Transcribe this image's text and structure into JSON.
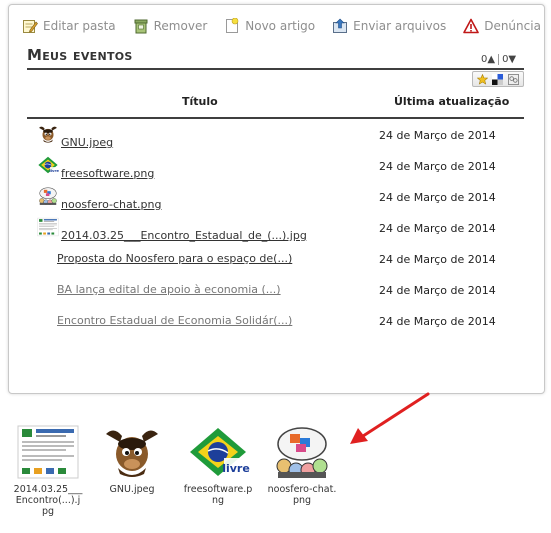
{
  "toolbar": {
    "edit_folder": "Editar pasta",
    "remove": "Remover",
    "new_article": "Novo artigo",
    "send_files": "Enviar arquivos",
    "report": "Denúncia"
  },
  "title": "Meus eventos",
  "votes": {
    "up": "0▲",
    "down": "0▼"
  },
  "table": {
    "headers": {
      "title": "Título",
      "updated": "Última atualização"
    },
    "rows": [
      {
        "name": "GNU.jpeg",
        "date": "24 de Março de 2014",
        "thumb": "gnu-thumbnail",
        "muted": false
      },
      {
        "name": "freesoftware.png",
        "date": "24 de Março de 2014",
        "thumb": "freesoftware-thumbnail",
        "muted": false
      },
      {
        "name": "noosfero-chat.png",
        "date": "24 de Março de 2014",
        "thumb": "noosfero-chat-thumbnail",
        "muted": false
      },
      {
        "name": "2014.03.25___Encontro_Estadual_de_(...).jpg",
        "date": "24 de Março de 2014",
        "thumb": "encontro-thumbnail",
        "muted": false
      },
      {
        "name": "Proposta do Noosfero para o espaço de(...)",
        "date": "24 de Março de 2014",
        "thumb": "",
        "muted": false
      },
      {
        "name": "BA lança edital de apoio à economia (...)",
        "date": "24 de Março de 2014",
        "thumb": "",
        "muted": true
      },
      {
        "name": "Encontro Estadual de Economia Solidár(...)",
        "date": "24 de Março de 2014",
        "thumb": "",
        "muted": true
      }
    ]
  },
  "gallery": [
    {
      "caption": "2014.03.25___Encontro(...).jpg",
      "icon": "encontro-image"
    },
    {
      "caption": "GNU.jpeg",
      "icon": "gnu-image"
    },
    {
      "caption": "freesoftware.png",
      "icon": "freesoftware-image"
    },
    {
      "caption": "noosfero-chat.png",
      "icon": "noosfero-chat-image"
    }
  ],
  "colors": {
    "link": "#333333",
    "muted_link": "#777777",
    "arrow": "#e02020"
  }
}
